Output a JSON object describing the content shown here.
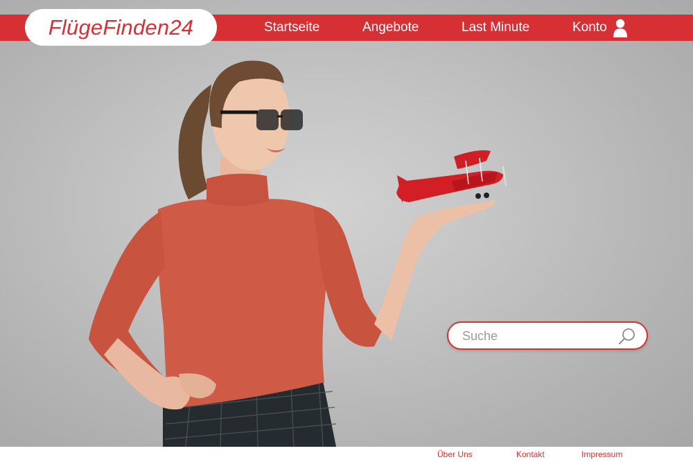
{
  "brand": {
    "logo_text": "FlügeFinden24",
    "accent_color": "#d62f34"
  },
  "nav": {
    "items": [
      {
        "label": "Startseite"
      },
      {
        "label": "Angebote"
      },
      {
        "label": "Last Minute"
      },
      {
        "label": "Konto"
      }
    ],
    "account_icon": "user-icon"
  },
  "search": {
    "placeholder": "Suche",
    "value": "",
    "icon": "search-icon"
  },
  "footer": {
    "links": [
      {
        "label": "Über Uns"
      },
      {
        "label": "Kontakt"
      },
      {
        "label": "Impressum"
      }
    ]
  }
}
